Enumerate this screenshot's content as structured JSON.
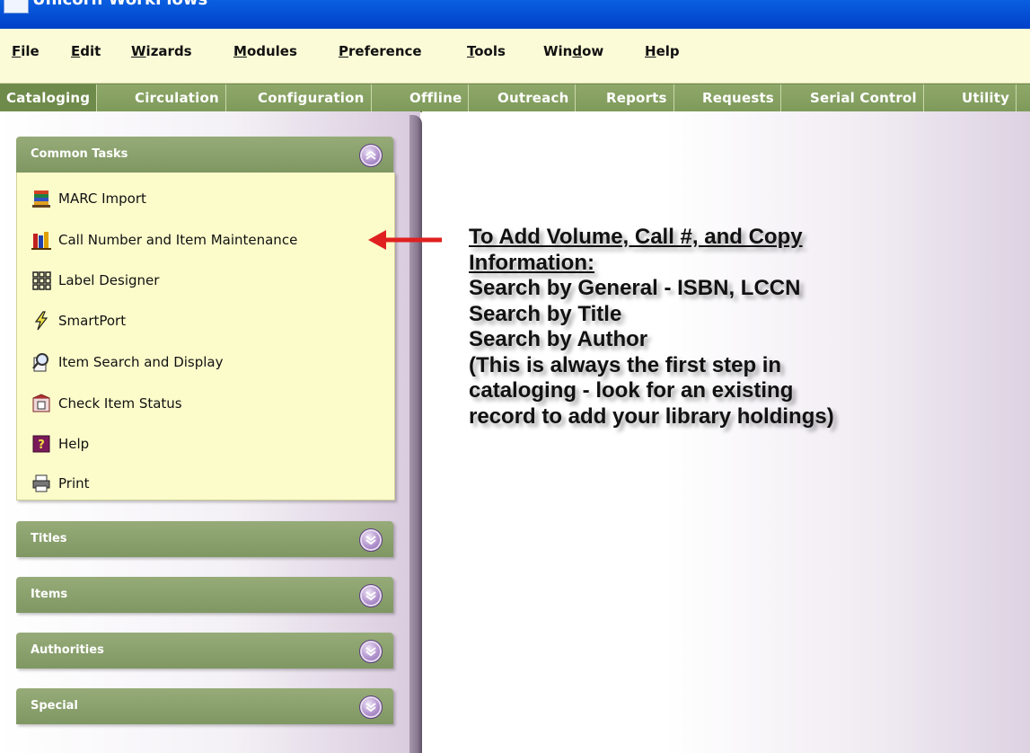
{
  "window": {
    "title": "Unicorn WorkFlows"
  },
  "menu": {
    "items": [
      {
        "label": "File",
        "accel": "F",
        "rest": "ile"
      },
      {
        "label": "Edit",
        "accel": "E",
        "rest": "dit"
      },
      {
        "label": "Wizards",
        "accel": "W",
        "rest": "izards"
      },
      {
        "label": "Modules",
        "accel": "M",
        "rest": "odules"
      },
      {
        "label": "Preference",
        "accel": "P",
        "rest": "reference"
      },
      {
        "label": "Tools",
        "accel": "T",
        "rest": "ools"
      },
      {
        "label": "Window",
        "pre": "Win",
        "accel": "d",
        "rest": "ow"
      },
      {
        "label": "Help",
        "accel": "H",
        "rest": "elp"
      }
    ]
  },
  "tabs": [
    {
      "label": "Cataloging",
      "active": true
    },
    {
      "label": "Circulation"
    },
    {
      "label": "Configuration"
    },
    {
      "label": "Offline"
    },
    {
      "label": "Outreach"
    },
    {
      "label": "Reports"
    },
    {
      "label": "Requests"
    },
    {
      "label": "Serial Control"
    },
    {
      "label": "Utility"
    }
  ],
  "groups": {
    "common": {
      "title": "Common Tasks",
      "items": [
        {
          "label": "MARC Import",
          "icon": "marc-import-icon"
        },
        {
          "label": "Call Number and Item Maintenance",
          "icon": "books-icon"
        },
        {
          "label": "Label Designer",
          "icon": "label-grid-icon"
        },
        {
          "label": "SmartPort",
          "icon": "lightning-icon"
        },
        {
          "label": "Item Search and Display",
          "icon": "magnifier-book-icon"
        },
        {
          "label": "Check Item Status",
          "icon": "status-book-icon"
        },
        {
          "label": "Help",
          "icon": "help-icon"
        },
        {
          "label": "Print",
          "icon": "printer-icon"
        }
      ]
    },
    "titles": {
      "title": "Titles"
    },
    "items": {
      "title": "Items"
    },
    "authorities": {
      "title": "Authorities"
    },
    "special": {
      "title": "Special"
    }
  },
  "annotation": {
    "heading_line1": "To Add Volume, Call #, and Copy",
    "heading_line2": "Information:",
    "line1": "Search by General - ISBN, LCCN",
    "line2": "Search by Title",
    "line3": "Search by Author",
    "line4": "(This is always the first step in",
    "line5": "cataloging - look for an existing",
    "line6": "record to add your library holdings)",
    "arrow_color": "#e02020"
  },
  "colors": {
    "titlebar": "#0048d0",
    "menubar": "#fbfbd7",
    "tab_green": "#7e9a5a",
    "panel_body": "#fcfccb",
    "toggle_purple": "#7f5aa6"
  }
}
